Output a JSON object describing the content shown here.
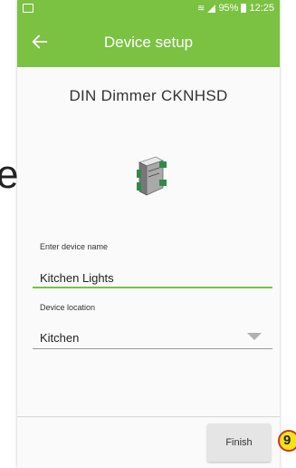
{
  "background": {
    "partial_letter": "e"
  },
  "status_bar": {
    "battery": "95%",
    "time": "12:25"
  },
  "app_bar": {
    "title": "Device setup",
    "back_icon": "arrow-left-icon",
    "color": "#7bc142"
  },
  "device": {
    "model": "DIN Dimmer CKNHSD"
  },
  "form": {
    "name_label": "Enter device name",
    "name_value": "Kitchen Lights",
    "location_label": "Device location",
    "location_value": "Kitchen"
  },
  "footer": {
    "finish_label": "Finish"
  },
  "annotation": {
    "step": "9"
  }
}
